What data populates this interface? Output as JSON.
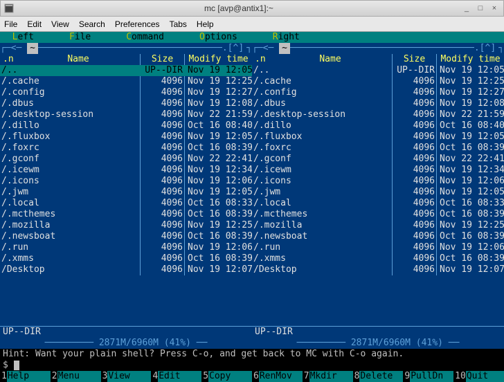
{
  "window": {
    "title": "mc [avp@antix1]:~"
  },
  "app_menu": [
    "File",
    "Edit",
    "View",
    "Search",
    "Preferences",
    "Tabs",
    "Help"
  ],
  "mc_menu": [
    {
      "hot": "L",
      "rest": "eft",
      "pad": "   "
    },
    {
      "hot": "F",
      "rest": "ile",
      "pad": "   "
    },
    {
      "hot": "C",
      "rest": "ommand",
      "pad": "   "
    },
    {
      "hot": "O",
      "rest": "ptions",
      "pad": "   "
    },
    {
      "hot": "R",
      "rest": "ight",
      "pad": ""
    }
  ],
  "panel_path": "~",
  "panel_caret": ".[^]",
  "columns": {
    "dot": ".n",
    "name": "Name",
    "size": "Size",
    "mtime": "Modify time"
  },
  "status_line": "UP--DIR",
  "disk_line": "─ 2871M/6960M (41%) ─",
  "files": [
    {
      "name": "/..",
      "size": "UP--DIR",
      "mtime": "Nov 19 12:05",
      "selected": true
    },
    {
      "name": "/.cache",
      "size": "4096",
      "mtime": "Nov 19 12:25"
    },
    {
      "name": "/.config",
      "size": "4096",
      "mtime": "Nov 19 12:27"
    },
    {
      "name": "/.dbus",
      "size": "4096",
      "mtime": "Nov 19 12:08"
    },
    {
      "name": "/.desktop-session",
      "size": "4096",
      "mtime": "Nov 22 21:59"
    },
    {
      "name": "/.dillo",
      "size": "4096",
      "mtime": "Oct 16 08:40"
    },
    {
      "name": "/.fluxbox",
      "size": "4096",
      "mtime": "Nov 19 12:05"
    },
    {
      "name": "/.foxrc",
      "size": "4096",
      "mtime": "Oct 16 08:39"
    },
    {
      "name": "/.gconf",
      "size": "4096",
      "mtime": "Nov 22 22:41"
    },
    {
      "name": "/.icewm",
      "size": "4096",
      "mtime": "Nov 19 12:34"
    },
    {
      "name": "/.icons",
      "size": "4096",
      "mtime": "Nov 19 12:06"
    },
    {
      "name": "/.jwm",
      "size": "4096",
      "mtime": "Nov 19 12:05"
    },
    {
      "name": "/.local",
      "size": "4096",
      "mtime": "Oct 16 08:33"
    },
    {
      "name": "/.mcthemes",
      "size": "4096",
      "mtime": "Oct 16 08:39"
    },
    {
      "name": "/.mozilla",
      "size": "4096",
      "mtime": "Nov 19 12:25"
    },
    {
      "name": "/.newsboat",
      "size": "4096",
      "mtime": "Oct 16 08:39"
    },
    {
      "name": "/.run",
      "size": "4096",
      "mtime": "Nov 19 12:06"
    },
    {
      "name": "/.xmms",
      "size": "4096",
      "mtime": "Oct 16 08:39"
    },
    {
      "name": "/Desktop",
      "size": "4096",
      "mtime": "Nov 19 12:07"
    }
  ],
  "hint": "Hint: Want your plain shell? Press C-o, and get back to MC with C-o again.",
  "prompt": "$ ",
  "fkeys": [
    {
      "n": "1",
      "label": "Help"
    },
    {
      "n": "2",
      "label": "Menu"
    },
    {
      "n": "3",
      "label": "View"
    },
    {
      "n": "4",
      "label": "Edit"
    },
    {
      "n": "5",
      "label": "Copy"
    },
    {
      "n": "6",
      "label": "RenMov"
    },
    {
      "n": "7",
      "label": "Mkdir"
    },
    {
      "n": "8",
      "label": "Delete"
    },
    {
      "n": "9",
      "label": "PullDn"
    },
    {
      "n": "10",
      "label": "Quit"
    }
  ]
}
